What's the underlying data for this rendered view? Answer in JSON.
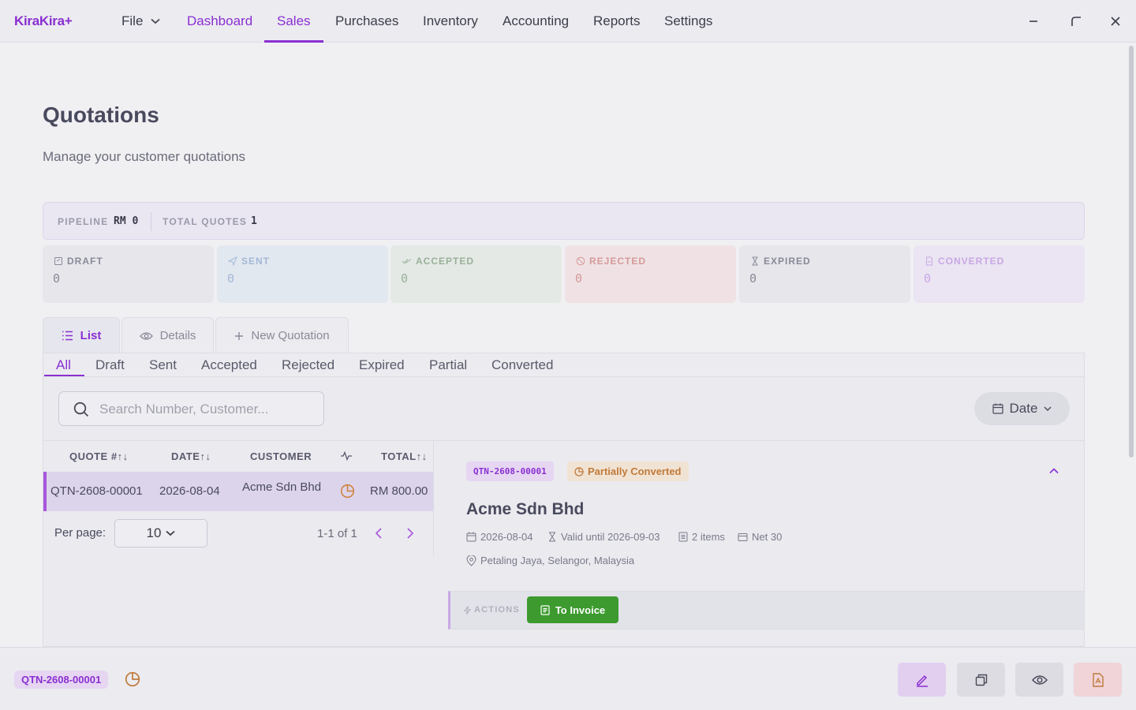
{
  "app": {
    "logo": "KiraKira+"
  },
  "nav": {
    "file": "File",
    "items": [
      "Dashboard",
      "Sales",
      "Purchases",
      "Inventory",
      "Accounting",
      "Reports",
      "Settings"
    ]
  },
  "page": {
    "title": "Quotations",
    "subtitle": "Manage your customer quotations"
  },
  "pipeline": {
    "pipeline_label": "PIPELINE",
    "pipeline_value": "RM 0",
    "total_label": "TOTAL QUOTES",
    "total_value": "1"
  },
  "stats": [
    {
      "label": "DRAFT",
      "value": "0",
      "color": "#8a8a98",
      "bg": "#e6e6eb"
    },
    {
      "label": "SENT",
      "value": "0",
      "color": "#a3b8d6",
      "bg": "#e2e8f0"
    },
    {
      "label": "ACCEPTED",
      "value": "0",
      "color": "#9ab09a",
      "bg": "#e4e9e5"
    },
    {
      "label": "REJECTED",
      "value": "0",
      "color": "#d69a9a",
      "bg": "#f0e2e4"
    },
    {
      "label": "EXPIRED",
      "value": "0",
      "color": "#8a8a98",
      "bg": "#e6e6eb"
    },
    {
      "label": "CONVERTED",
      "value": "0",
      "color": "#c8a8e6",
      "bg": "#ebe4f2"
    }
  ],
  "tabs": {
    "list": "List",
    "details": "Details",
    "new": "New Quotation"
  },
  "filters": [
    "All",
    "Draft",
    "Sent",
    "Accepted",
    "Rejected",
    "Expired",
    "Partial",
    "Converted"
  ],
  "search": {
    "placeholder": "Search Number, Customer..."
  },
  "date_button": "Date",
  "table": {
    "headers": {
      "quote": "QUOTE #",
      "date": "DATE",
      "customer": "CUSTOMER",
      "total": "TOTAL"
    },
    "rows": [
      {
        "quote": "QTN-2608-00001",
        "date": "2026-08-04",
        "customer": "Acme Sdn Bhd",
        "total": "RM 800.00"
      }
    ]
  },
  "pagination": {
    "per_page_label": "Per page:",
    "per_page": "10",
    "info": "1-1 of 1"
  },
  "detail": {
    "id": "QTN-2608-00001",
    "status": "Partially Converted",
    "customer": "Acme Sdn Bhd",
    "date": "2026-08-04",
    "valid_until": "Valid until 2026-09-03",
    "items": "2 items",
    "terms": "Net 30",
    "location": "Petaling Jaya, Selangor, Malaysia",
    "actions_label": "ACTIONS",
    "to_invoice": "To Invoice"
  },
  "footer": {
    "chip": "QTN-2608-00001"
  },
  "colors": {
    "accent": "#8a2fd1",
    "success": "#3c9a2e",
    "warning": "#c07a3a"
  }
}
